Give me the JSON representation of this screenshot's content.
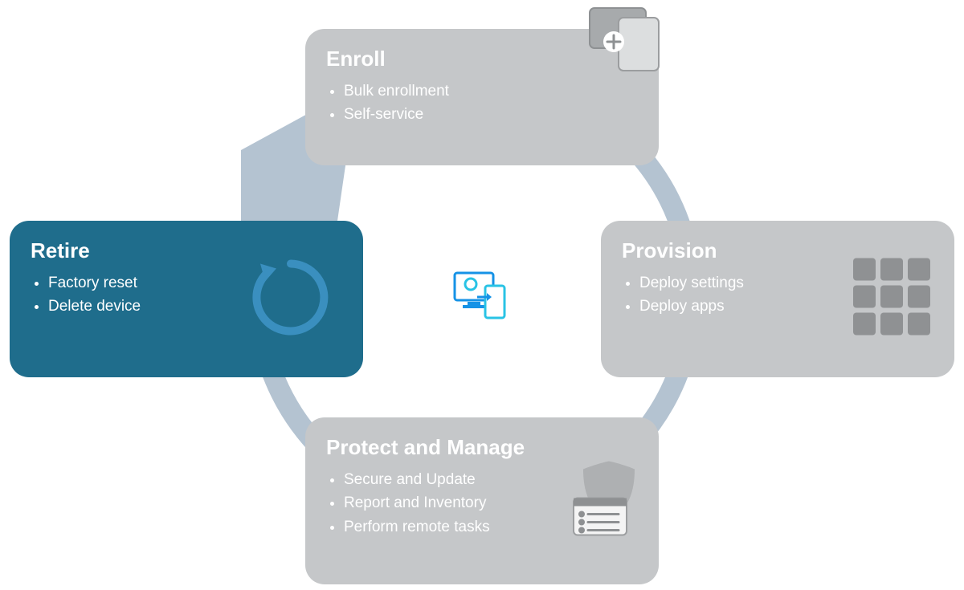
{
  "cycle": {
    "center_icon": "device-management-icon",
    "stages": [
      {
        "key": "enroll",
        "title": "Enroll",
        "items": [
          "Bulk enrollment",
          "Self-service"
        ],
        "icon": "devices-add-icon",
        "highlighted": false
      },
      {
        "key": "provision",
        "title": "Provision",
        "items": [
          "Deploy settings",
          "Deploy apps"
        ],
        "icon": "apps-grid-icon",
        "highlighted": false
      },
      {
        "key": "protect",
        "title": "Protect and Manage",
        "items": [
          "Secure and Update",
          "Report and Inventory",
          "Perform remote tasks"
        ],
        "icon": "shield-list-icon",
        "highlighted": false
      },
      {
        "key": "retire",
        "title": "Retire",
        "items": [
          "Factory reset",
          "Delete device"
        ],
        "icon": "reset-circle-icon",
        "highlighted": true
      }
    ]
  },
  "colors": {
    "card_gray": "#c5c7c9",
    "card_blue": "#1f6d8c",
    "ring": "#b4c3d1",
    "accent_blue": "#2c86b8",
    "icon_blue": "#1592e6",
    "icon_cyan": "#29c3e5"
  }
}
